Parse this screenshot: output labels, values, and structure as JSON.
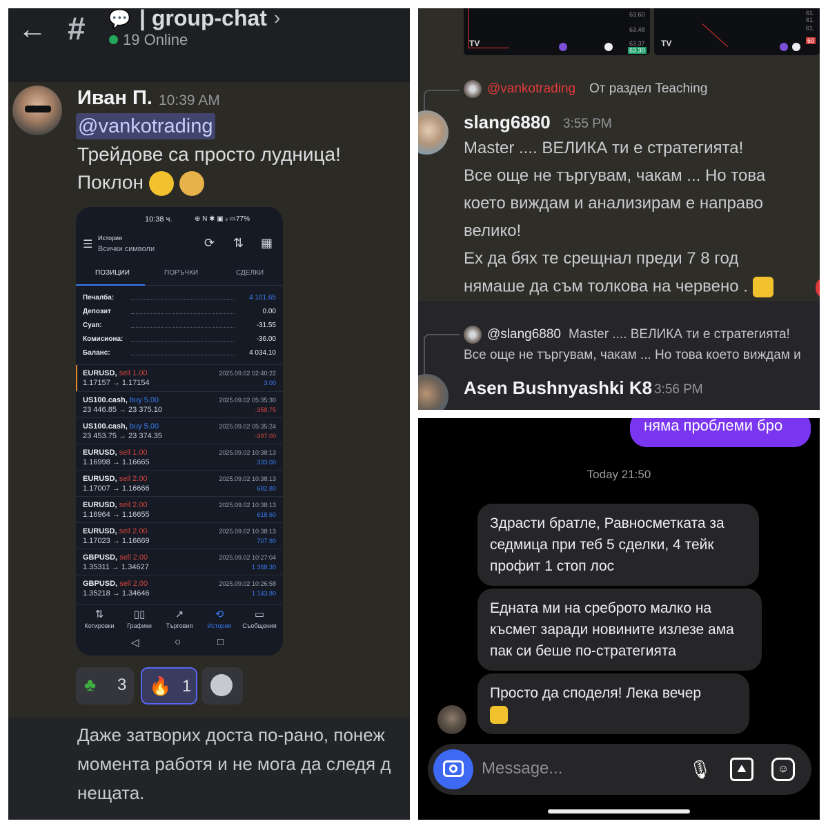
{
  "discord_top": {
    "channel_title": "| group-chat",
    "online_text": "19 Online",
    "message1": {
      "author": "Иван П.",
      "time": "10:39 AM",
      "mention": "@vankotrading",
      "line1": "Трейдове са просто лудница!",
      "line2": "Поклон"
    },
    "phone": {
      "time": "10:38 ч.",
      "status_icons": "⊕ N ✱ ▣ ᵢₗ ▭77%",
      "history_label": "История",
      "symbols_label": "Всички символи",
      "tabs": [
        "ПОЗИЦИИ",
        "ПОРЪЧКИ",
        "СДЕЛКИ"
      ],
      "summary": [
        {
          "label": "Печалба:",
          "value": "4 101.65"
        },
        {
          "label": "Депозит",
          "value": "0.00"
        },
        {
          "label": "Суап:",
          "value": "-31.55"
        },
        {
          "label": "Комисиона:",
          "value": "-36.00"
        },
        {
          "label": "Баланс:",
          "value": "4 034.10"
        }
      ],
      "deals": [
        {
          "symbol": "EURUSD,",
          "side": "sell 1.00",
          "prices": "1.17157 → 1.17154",
          "date": "2025.09.02 02:40:22",
          "pnl": "3.00"
        },
        {
          "symbol": "US100.cash,",
          "side": "buy 5.00",
          "prices": "23 446.85 → 23 375.10",
          "date": "2025.09.02 05:35:30",
          "pnl": "-358.75"
        },
        {
          "symbol": "US100.cash,",
          "side": "buy 5.00",
          "prices": "23 453.75 → 23 374.35",
          "date": "2025.09.02 05:35:24",
          "pnl": "-397.00"
        },
        {
          "symbol": "EURUSD,",
          "side": "sell 1.00",
          "prices": "1.16998 → 1.16665",
          "date": "2025.09.02 10:38:13",
          "pnl": "333.00"
        },
        {
          "symbol": "EURUSD,",
          "side": "sell 2.00",
          "prices": "1.17007 → 1.16666",
          "date": "2025.09.02 10:38:13",
          "pnl": "682.80"
        },
        {
          "symbol": "EURUSD,",
          "side": "sell 2.00",
          "prices": "1.16964 → 1.16655",
          "date": "2025.09.02 10:38:13",
          "pnl": "618.60"
        },
        {
          "symbol": "EURUSD,",
          "side": "sell 2.00",
          "prices": "1.17023 → 1.16669",
          "date": "2025.09.02 10:38:13",
          "pnl": "707.90"
        },
        {
          "symbol": "GBPUSD,",
          "side": "sell 2.00",
          "prices": "1.35311 → 1.34627",
          "date": "2025.09.02 10:27:04",
          "pnl": "1 368.30"
        },
        {
          "symbol": "GBPUSD,",
          "side": "sell 2.00",
          "prices": "1.35218 → 1.34646",
          "date": "2025.09.02 10:26:58",
          "pnl": "1 143.80"
        }
      ],
      "nav": [
        "Котировки",
        "Графики",
        "Търговия",
        "История",
        "Съобщения"
      ]
    },
    "reactions": [
      {
        "icon": "clover",
        "count": "3"
      },
      {
        "icon": "fire",
        "count": "1"
      }
    ],
    "message2": {
      "line1": "Даже затворих доста по-рано, понеж",
      "line2": "момента работя и не мога да следя д",
      "line3": "нещата."
    }
  },
  "discord_right": {
    "chart_ticks": [
      "63.60",
      "63.48",
      "63.37",
      "63.30",
      "61.",
      "61.",
      "61.",
      "60"
    ],
    "reply1": {
      "mention": "@vankotrading",
      "text": "От раздел Teaching"
    },
    "message": {
      "author": "slang6880",
      "time": "3:55 PM",
      "lines": [
        "Master .... ВЕЛИКА ти е стратегията!",
        "Все още не търгувам, чакам ... Но това",
        "което виждам и анализирам е направо",
        "велико!",
        "Ех да бях те срещнал преди  7 8 год",
        "нямаше да съм толкова на червено ."
      ]
    },
    "reply2": {
      "mention": "@slang6880",
      "text": " Master .... ВЕЛИКА ти е стратегията!",
      "line2": "Все още не търгувам, чакам ... Но това което виждам и"
    },
    "message3": {
      "author": "Asen Bushnyashki K8",
      "time": "3:56 PM"
    }
  },
  "dm": {
    "outgoing": "няма проблеми бро",
    "timestamp": "Today 21:50",
    "incoming": [
      "Здрасти братле, Равносметката за седмица при теб 5 сделки, 4 тейк профит 1 стоп лос",
      "Едната ми на среброто малко на късмет заради новините излезе ама пак си беше по-стратегията",
      "Просто да споделя! Лека вечер"
    ],
    "composer_placeholder": "Message..."
  }
}
